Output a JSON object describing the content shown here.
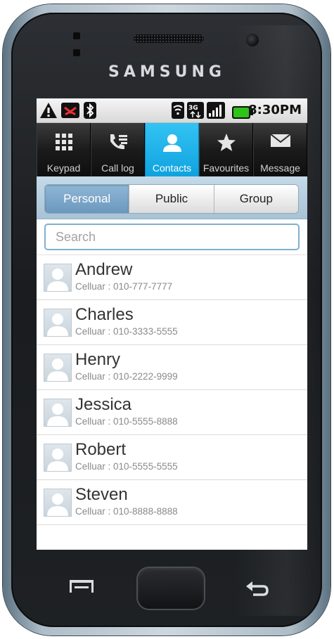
{
  "device": {
    "brand": "SAMSUNG"
  },
  "statusbar": {
    "time": "8:30PM"
  },
  "tabs": [
    {
      "label": "Keypad",
      "icon": "keypad-icon",
      "active": false
    },
    {
      "label": "Call log",
      "icon": "call-log-icon",
      "active": false
    },
    {
      "label": "Contacts",
      "icon": "contacts-icon",
      "active": true
    },
    {
      "label": "Favourites",
      "icon": "star-icon",
      "active": false
    },
    {
      "label": "Message",
      "icon": "envelope-icon",
      "active": false
    }
  ],
  "segments": [
    {
      "label": "Personal",
      "active": true
    },
    {
      "label": "Public",
      "active": false
    },
    {
      "label": "Group",
      "active": false
    }
  ],
  "search": {
    "placeholder": "Search",
    "value": ""
  },
  "contacts": [
    {
      "name": "Andrew",
      "detail": "Celluar : 010-777-7777"
    },
    {
      "name": "Charles",
      "detail": "Celluar : 010-3333-5555"
    },
    {
      "name": "Henry",
      "detail": "Celluar : 010-2222-9999"
    },
    {
      "name": "Jessica",
      "detail": "Celluar : 010-5555-8888"
    },
    {
      "name": "Robert",
      "detail": "Celluar : 010-5555-5555"
    },
    {
      "name": "Steven",
      "detail": "Celluar : 010-8888-8888"
    }
  ],
  "colors": {
    "active_tab": "#0fa2df",
    "segment_active": "#6c98bd",
    "battery": "#2fc21a"
  }
}
